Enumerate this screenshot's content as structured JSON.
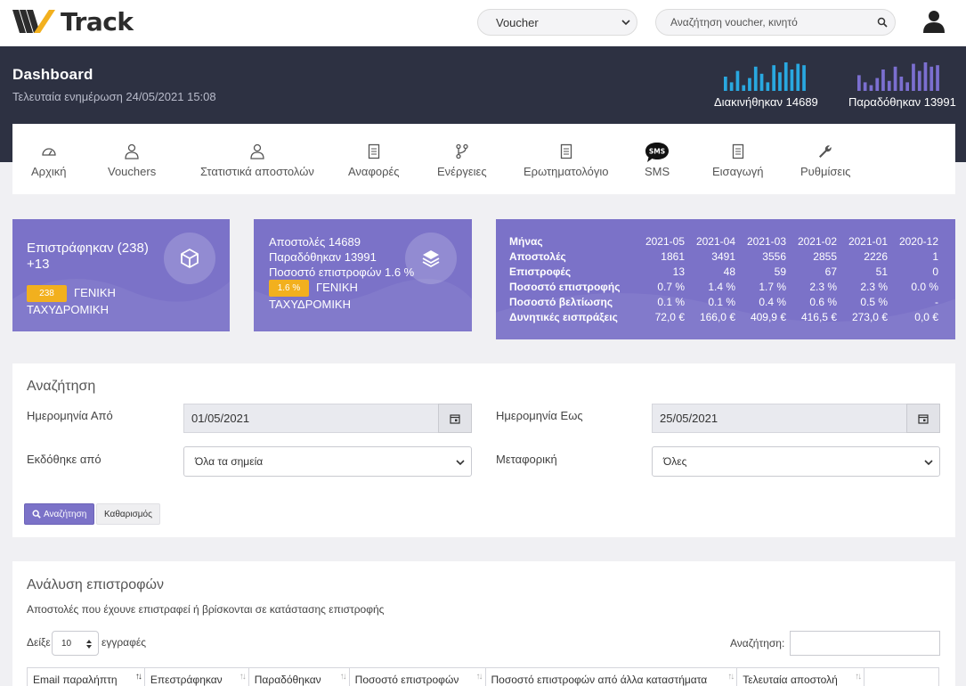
{
  "brand": {
    "name": "Track"
  },
  "topbar": {
    "selector_value": "Voucher",
    "search_placeholder": "Αναζήτηση voucher, κινητό"
  },
  "header": {
    "title": "Dashboard",
    "last_update": "Τελευταία ενημέρωση 24/05/2021 15:08",
    "spark_left": {
      "label": "Διακινήθηκαν 14689",
      "color": "#29a8e0",
      "values": [
        0.5,
        0.3,
        0.7,
        0.2,
        0.45,
        0.85,
        0.6,
        0.3,
        0.9,
        0.65,
        1.0,
        0.75,
        0.95,
        0.9
      ]
    },
    "spark_right": {
      "label": "Παραδόθηκαν 13991",
      "color": "#7b6fd0",
      "values": [
        0.55,
        0.3,
        0.2,
        0.45,
        0.75,
        0.35,
        0.85,
        0.5,
        0.3,
        0.95,
        0.7,
        1.0,
        0.85,
        0.9
      ]
    }
  },
  "nav": {
    "items": [
      {
        "label": "Αρχική",
        "icon": "dashboard-gauge-icon"
      },
      {
        "label": "Vouchers",
        "icon": "user-icon"
      },
      {
        "label": "Στατιστικά αποστολών",
        "icon": "user-icon"
      },
      {
        "label": "Αναφορές",
        "icon": "document-icon"
      },
      {
        "label": "Ενέργειες",
        "icon": "branch-icon"
      },
      {
        "label": "Ερωτηματολόγιο",
        "icon": "document-icon"
      },
      {
        "label": "SMS",
        "icon": "sms-bubble-icon"
      },
      {
        "label": "Εισαγωγή",
        "icon": "document-icon"
      },
      {
        "label": "Ρυθμίσεις",
        "icon": "wrench-icon"
      }
    ]
  },
  "returns_card": {
    "title": "Επιστράφηκαν (238) +13",
    "badge": "238",
    "carrier": "ΓΕΝΙΚΗ ΤΑΧΥΔΡΟΜΙΚΗ"
  },
  "shipments_card": {
    "line1": "Αποστολές 14689",
    "line2": "Παραδόθηκαν 13991",
    "line3": "Ποσοστό επιστροφών 1.6 %",
    "badge": "1.6 %",
    "carrier": "ΓΕΝΙΚΗ ΤΑΧΥΔΡΟΜΙΚΗ"
  },
  "monthly": {
    "row_headers": [
      "Μήνας",
      "Αποστολές",
      "Επιστροφές",
      "Ποσοστό επιστροφής",
      "Ποσοστό βελτίωσης",
      "Δυνητικές εισπράξεις"
    ],
    "rows": [
      [
        "2021-05",
        "2021-04",
        "2021-03",
        "2021-02",
        "2021-01",
        "2020-12"
      ],
      [
        "1861",
        "3491",
        "3556",
        "2855",
        "2226",
        "1"
      ],
      [
        "13",
        "48",
        "59",
        "67",
        "51",
        "0"
      ],
      [
        "0.7 %",
        "1.4 %",
        "1.7 %",
        "2.3 %",
        "2.3 %",
        "0.0 %"
      ],
      [
        "0.1 %",
        "0.1 %",
        "0.4 %",
        "0.6 %",
        "0.5 %",
        "-"
      ],
      [
        "72,0 €",
        "166,0 €",
        "409,9 €",
        "416,5 €",
        "273,0 €",
        "0,0 €"
      ]
    ]
  },
  "search": {
    "title": "Αναζήτηση",
    "date_from_label": "Ημερομηνία Από",
    "date_from_value": "01/05/2021",
    "date_to_label": "Ημερομηνία Εως",
    "date_to_value": "25/05/2021",
    "issued_label": "Εκδόθηκε από",
    "issued_value": "Όλα τα σημεία",
    "carrier_label": "Μεταφορική",
    "carrier_value": "Όλες",
    "search_button": "Αναζήτηση",
    "clear_button": "Καθαρισμός"
  },
  "analysis": {
    "title": "Ανάλυση επιστροφών",
    "subtitle": "Αποστολές που έχουνε επιστραφεί ή βρίσκονται σε κατάστασης επιστροφής",
    "show_prefix": "Δείξε",
    "page_length": "10",
    "show_suffix": "εγγραφές",
    "search_label": "Αναζήτηση:",
    "columns": [
      "Email παραλήπτη",
      "Επεστράφηκαν",
      "Παραδόθηκαν",
      "Ποσοστό επιστροφών",
      "Ποσοστό επιστροφών από άλλα καταστήματα",
      "Τελευταία αποστολή",
      ""
    ]
  },
  "colors": {
    "accent": "#7b72c8",
    "dark_header": "#2d3142",
    "badge": "#f2b01e"
  }
}
